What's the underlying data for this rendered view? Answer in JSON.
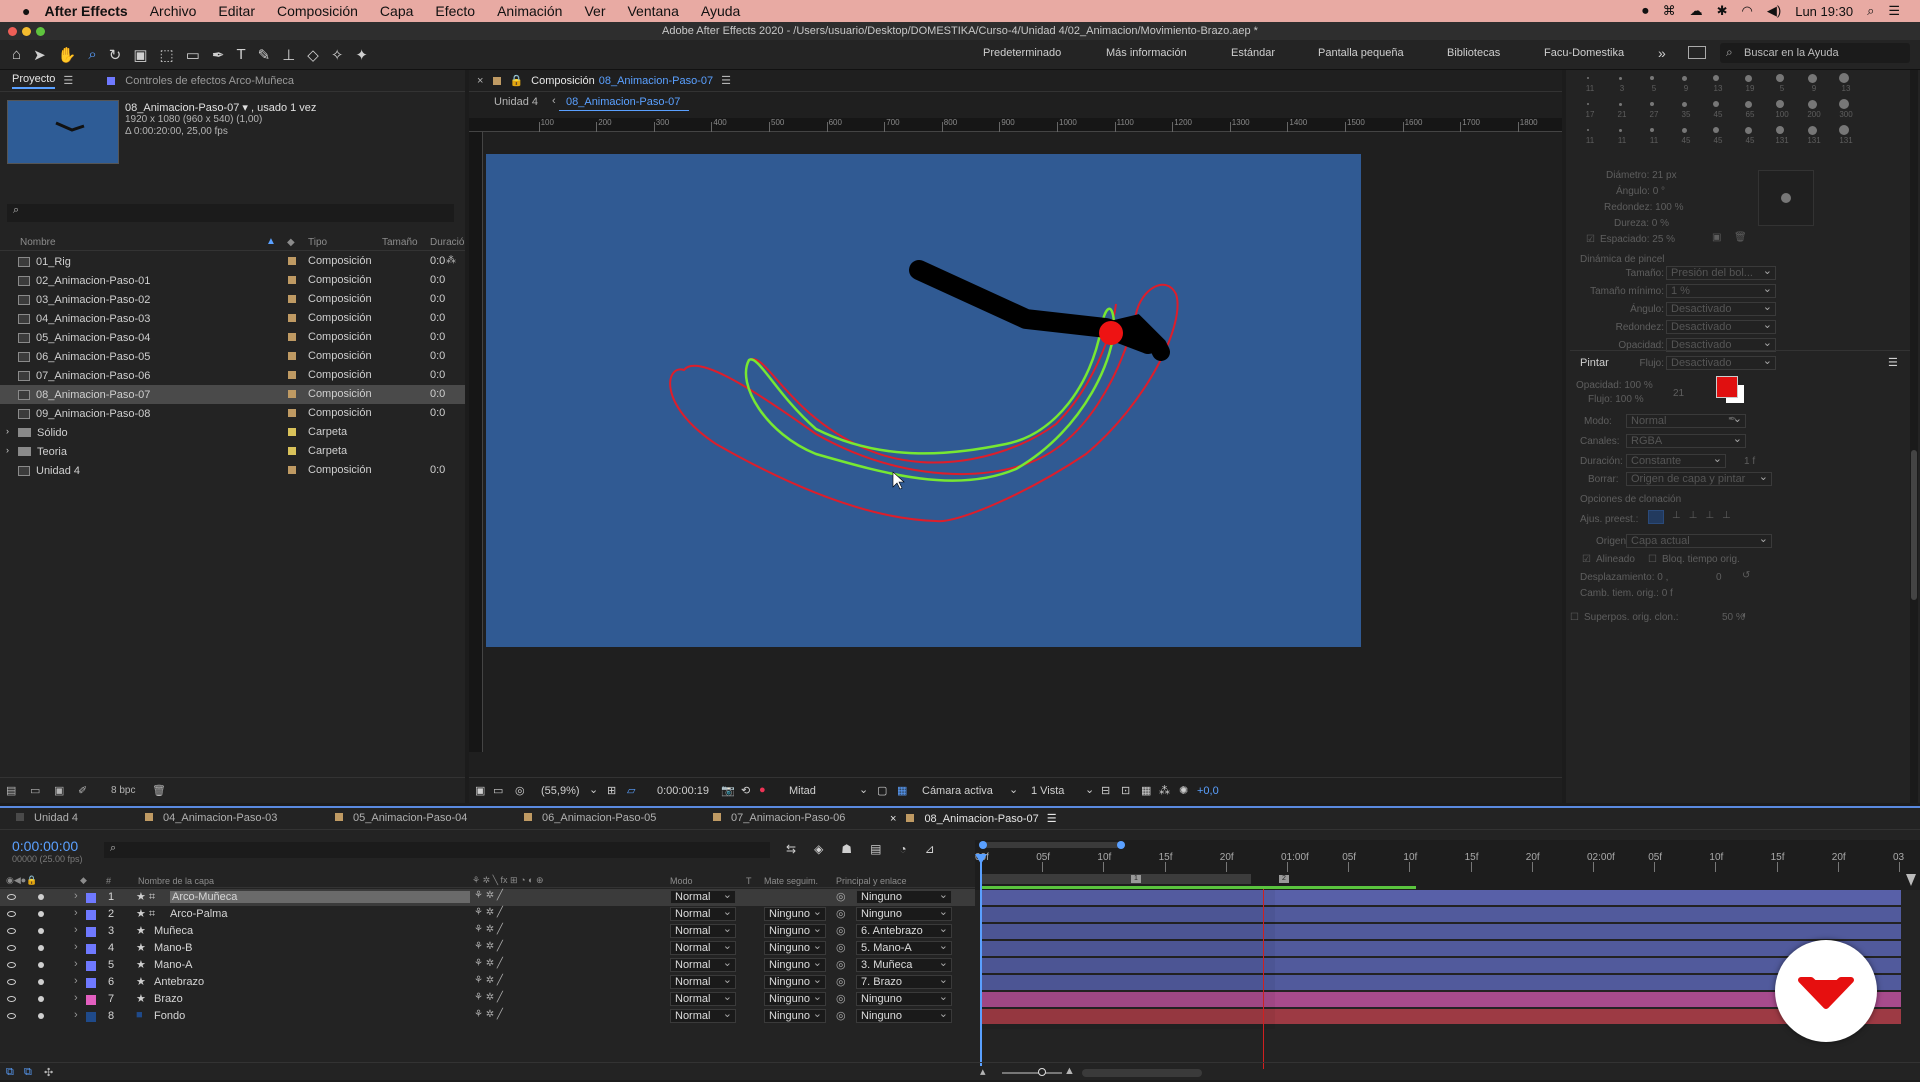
{
  "menu": {
    "app": "After Effects",
    "items": [
      "Archivo",
      "Editar",
      "Composición",
      "Capa",
      "Efecto",
      "Animación",
      "Ver",
      "Ventana",
      "Ayuda"
    ],
    "clock": "Lun 19:30"
  },
  "title": "Adobe After Effects 2020 - /Users/usuario/Desktop/DOMESTIKA/Curso-4/Unidad 4/02_Animacion/Movimiento-Brazo.aep *",
  "workspaces": [
    "Predeterminado",
    "Más información",
    "Estándar",
    "Pantalla pequeña",
    "Bibliotecas",
    "Facu-Domestika"
  ],
  "help_placeholder": "Buscar en la Ayuda",
  "project": {
    "tab": "Proyecto",
    "effects_tab": "Controles de efectos Arco-Muñeca",
    "sel_name": "08_Animacion-Paso-07 ▾ , usado 1 vez",
    "sel_size": "1920 x 1080  (960 x 540) (1,00)",
    "sel_dur": "Δ 0:00:20:00, 25,00 fps",
    "cols": {
      "name": "Nombre",
      "type": "Tipo",
      "size": "Tamaño",
      "dur": "Duració"
    },
    "items": [
      {
        "name": "01_Rig",
        "type": "Composición",
        "dur": "0:0",
        "kind": "comp"
      },
      {
        "name": "02_Animacion-Paso-01",
        "type": "Composición",
        "dur": "0:0",
        "kind": "comp"
      },
      {
        "name": "03_Animacion-Paso-02",
        "type": "Composición",
        "dur": "0:0",
        "kind": "comp"
      },
      {
        "name": "04_Animacion-Paso-03",
        "type": "Composición",
        "dur": "0:0",
        "kind": "comp"
      },
      {
        "name": "05_Animacion-Paso-04",
        "type": "Composición",
        "dur": "0:0",
        "kind": "comp"
      },
      {
        "name": "06_Animacion-Paso-05",
        "type": "Composición",
        "dur": "0:0",
        "kind": "comp"
      },
      {
        "name": "07_Animacion-Paso-06",
        "type": "Composición",
        "dur": "0:0",
        "kind": "comp"
      },
      {
        "name": "08_Animacion-Paso-07",
        "type": "Composición",
        "dur": "0:0",
        "kind": "comp",
        "selected": true
      },
      {
        "name": "09_Animacion-Paso-08",
        "type": "Composición",
        "dur": "0:0",
        "kind": "comp"
      },
      {
        "name": "Sólido",
        "type": "Carpeta",
        "dur": "",
        "kind": "folder"
      },
      {
        "name": "Teoria",
        "type": "Carpeta",
        "dur": "",
        "kind": "folder"
      },
      {
        "name": "Unidad 4",
        "type": "Composición",
        "dur": "0:0",
        "kind": "comp"
      }
    ],
    "bpc": "8 bpc"
  },
  "comp": {
    "tab_prefix": "Composición",
    "tab_name": "08_Animacion-Paso-07",
    "crumb1": "Unidad 4",
    "crumb2": "08_Animacion-Paso-07",
    "ruler": [
      "100",
      "200",
      "300",
      "400",
      "500",
      "600",
      "700",
      "800",
      "900",
      "1000",
      "1100",
      "1200",
      "1300",
      "1400",
      "1500",
      "1600",
      "1700",
      "1800"
    ],
    "zoom": "(55,9%)",
    "time": "0:00:00:19",
    "resolution": "Mitad",
    "camera": "Cámara activa",
    "views": "1 Vista",
    "exposure": "+0,0"
  },
  "paint": {
    "brush_sizes": [
      "11",
      "3",
      "5",
      "9",
      "13",
      "19",
      "5",
      "9",
      "13",
      "17",
      "21",
      "27",
      "35",
      "45",
      "65",
      "100",
      "200",
      "300",
      "11",
      "11",
      "11",
      "45",
      "45",
      "45",
      "131",
      "131",
      "131"
    ],
    "diametro": "Diámetro: 21 px",
    "angulo": "Ángulo: 0 °",
    "redondez": "Redondez: 100 %",
    "dureza": "Dureza: 0 %",
    "espaciado": "Espaciado: 25 %",
    "dyn_title": "Dinámica de pincel",
    "dyn": [
      {
        "k": "Tamaño:",
        "v": "Presión del bol..."
      },
      {
        "k": "Tamaño mínimo:",
        "v": "1 %"
      },
      {
        "k": "Ángulo:",
        "v": "Desactivado"
      },
      {
        "k": "Redondez:",
        "v": "Desactivado"
      },
      {
        "k": "Opacidad:",
        "v": "Desactivado"
      },
      {
        "k": "Flujo:",
        "v": "Desactivado"
      }
    ],
    "title": "Pintar",
    "opacidad": "Opacidad: 100 %",
    "flujo": "Flujo: 100 %",
    "num21": "21",
    "color": "#e01010",
    "modo_k": "Modo:",
    "modo_v": "Normal",
    "canales_k": "Canales:",
    "canales_v": "RGBA",
    "duracion_k": "Duración:",
    "duracion_v": "Constante",
    "dur_n": "1 f",
    "borrar_k": "Borrar:",
    "borrar_v": "Origen de capa y pintar",
    "clon_title": "Opciones de clonación",
    "ajus": "Ajus. preest.:",
    "origen_k": "Origen:",
    "origen_v": "Capa actual",
    "alineado": "Alineado",
    "bloq": "Bloq. tiempo orig.",
    "desp": "Desplazamiento: 0 ,",
    "desp2": "0",
    "camb": "Camb. tiem. orig.: 0 f",
    "superp": "Superpos. orig. clon.:",
    "superp_v": "50 %"
  },
  "timeline": {
    "tabs": [
      "Unidad 4",
      "04_Animacion-Paso-03",
      "05_Animacion-Paso-04",
      "06_Animacion-Paso-05",
      "07_Animacion-Paso-06",
      "08_Animacion-Paso-07"
    ],
    "time": "0:00:00:00",
    "fps": "00000 (25.00 fps)",
    "cols": {
      "num": "#",
      "name": "Nombre de la capa",
      "mode": "Modo",
      "t": "T",
      "matte": "Mate seguim.",
      "parent": "Principal y enlace"
    },
    "ruler": [
      "00f",
      "05f",
      "10f",
      "15f",
      "20f",
      "01:00f",
      "05f",
      "10f",
      "15f",
      "20f",
      "02:00f",
      "05f",
      "10f",
      "15f",
      "20f",
      "03"
    ],
    "layers": [
      {
        "num": "1",
        "name": "Arco-Muñeca",
        "mode": "Normal",
        "matte": "",
        "parent": "Ninguno",
        "color": "#6f79ff",
        "bar": "#5860a8"
      },
      {
        "num": "2",
        "name": "Arco-Palma",
        "mode": "Normal",
        "matte": "Ninguno",
        "parent": "Ninguno",
        "color": "#6f79ff",
        "bar": "#515a9c"
      },
      {
        "num": "3",
        "name": "Muñeca",
        "mode": "Normal",
        "matte": "Ninguno",
        "parent": "6. Antebrazo",
        "color": "#6f79ff",
        "bar": "#515a9c"
      },
      {
        "num": "4",
        "name": "Mano-B",
        "mode": "Normal",
        "matte": "Ninguno",
        "parent": "5. Mano-A",
        "color": "#6f79ff",
        "bar": "#515a9c"
      },
      {
        "num": "5",
        "name": "Mano-A",
        "mode": "Normal",
        "matte": "Ninguno",
        "parent": "3. Muñeca",
        "color": "#6f79ff",
        "bar": "#515a9c"
      },
      {
        "num": "6",
        "name": "Antebrazo",
        "mode": "Normal",
        "matte": "Ninguno",
        "parent": "7. Brazo",
        "color": "#6f79ff",
        "bar": "#515a9c"
      },
      {
        "num": "7",
        "name": "Brazo",
        "mode": "Normal",
        "matte": "Ninguno",
        "parent": "Ninguno",
        "color": "#e35fbf",
        "bar": "#a74b8c"
      },
      {
        "num": "8",
        "name": "Fondo",
        "mode": "Normal",
        "matte": "Ninguno",
        "parent": "Ninguno",
        "color": "#1f4a8a",
        "bar": "#9d3a44"
      }
    ]
  }
}
